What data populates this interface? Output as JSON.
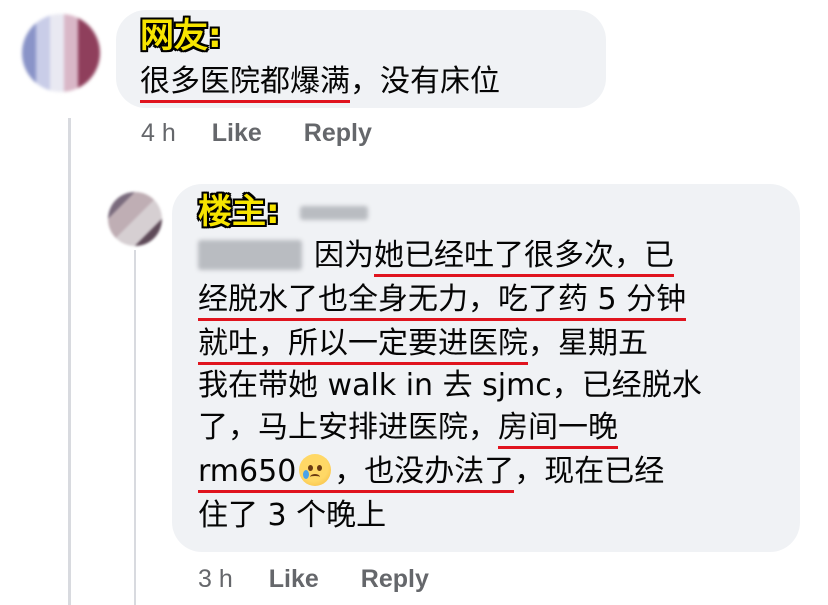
{
  "comment1": {
    "tag": "网友:",
    "text_underlined": "很多医院都爆满",
    "text_rest": "，没有床位",
    "time": "4 h",
    "like": "Like",
    "reply": "Reply"
  },
  "comment2": {
    "tag": "楼主:",
    "line1_pre": "因为",
    "line1_ul": "她已经吐了很多次，已",
    "line2_ul": "经脱水了也全身无力，吃了药 5 分钟",
    "line3_ul": "就吐，所以一定要进医院",
    "line3_rest": "，星期五",
    "line4": "我在带她 walk in 去 sjmc，已经脱水",
    "line5_pre": "了，马上安排进医院，",
    "line5_ul": "房间一晚",
    "line6_ul": "rm650",
    "line6_ul2": "，也没办法了",
    "line6_rest": "，现在已经",
    "line7": "住了 3 个晚上",
    "emoji_icon": "crying-face-emoji",
    "time": "3 h",
    "like": "Like",
    "reply": "Reply"
  },
  "colors": {
    "bubble": "#f0f2f5",
    "underline": "#e0141e",
    "tag_fill": "#f7e400",
    "meta": "#65676b"
  }
}
